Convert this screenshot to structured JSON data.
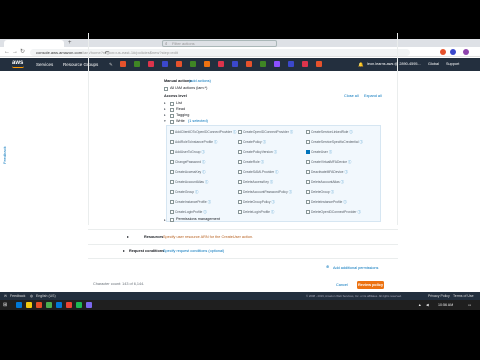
{
  "browser": {
    "url": "console.aws.amazon.com",
    "url_rest": "/iam/home?region=us-east-1#/policies$new?step=edit",
    "new_tab_glyph": "+"
  },
  "aws_nav": {
    "logo": "aws",
    "services_label": "Services",
    "resource_groups_label": "Resource Groups",
    "account_label": "leon.learns.aws @ 2890-4595...",
    "region_label": "Global",
    "support_label": "Support",
    "service_icon_colors": [
      "#e6522c",
      "#3f8624",
      "#dd344c",
      "#3b48cc",
      "#e6522c",
      "#3f8624",
      "#ec7211",
      "#dd344c",
      "#3b48cc",
      "#e6522c",
      "#3f8624",
      "#8c4fff",
      "#3b48cc",
      "#dd344c",
      "#e6522c"
    ]
  },
  "sidebar": {
    "feedback_tab": "Feedback"
  },
  "editor": {
    "search_placeholder": "Filter actions",
    "manual_actions_label": "Manual actions",
    "manual_actions_link": "(add actions)",
    "all_actions_label": "All IAM actions (iam:*)",
    "close_all_link": "Close all",
    "expand_all_link": "Expand all",
    "access_level_label": "Access level",
    "levels": [
      {
        "label": "List",
        "checked": false
      },
      {
        "label": "Read",
        "checked": false
      },
      {
        "label": "Tagging",
        "checked": false
      },
      {
        "label": "Write",
        "suffix": "(1 selected)",
        "checked": false
      }
    ],
    "write_actions": [
      [
        "AddClientIDToOpenIDConnectProvider",
        "CreateOpenIDConnectProvider",
        "CreateServiceLinkedRole"
      ],
      [
        "AddRoleToInstanceProfile",
        "CreatePolicy",
        "CreateServiceSpecificCredential"
      ],
      [
        "AddUserToGroup",
        "CreatePolicyVersion",
        "CreateUser"
      ],
      [
        "ChangePassword",
        "CreateRole",
        "CreateVirtualMFADevice"
      ],
      [
        "CreateAccessKey",
        "CreateSAMLProvider",
        "DeactivateMFADevice"
      ],
      [
        "CreateAccountAlias",
        "DeleteAccessKey",
        "DeleteAccountAlias"
      ],
      [
        "CreateGroup",
        "DeleteAccountPasswordPolicy",
        "DeleteGroup"
      ],
      [
        "CreateInstanceProfile",
        "DeleteGroupPolicy",
        "DeleteInstanceProfile"
      ],
      [
        "CreateLoginProfile",
        "DeleteLoginProfile",
        "DeleteOpenIDConnectProvider"
      ]
    ],
    "checked_action": "CreateUser",
    "permissions_management_label": "Permissions management"
  },
  "resources": {
    "label": "Resources",
    "text": "Specify user resource ARN for the CreateUser action."
  },
  "request_conditions": {
    "label": "Request conditions",
    "text": "Specify request conditions (optional)"
  },
  "actions": {
    "add_permissions": "Add additional permissions",
    "character_count": "Character count: 143 of 6,144.",
    "cancel": "Cancel",
    "review": "Review policy"
  },
  "aws_footer": {
    "feedback": "Feedback",
    "language": "English (US)",
    "copyright": "© 2008 - 2019, Amazon Web Services, Inc. or its affiliates. All rights reserved.",
    "privacy": "Privacy Policy",
    "terms": "Terms of Use"
  },
  "taskbar": {
    "time": "10:56 AM",
    "icon_colors": [
      "#0078d7",
      "#f2c811",
      "#e44d26",
      "#4caf50",
      "#0078d7",
      "#ea4335",
      "#1db954",
      "#7b68ee"
    ]
  }
}
